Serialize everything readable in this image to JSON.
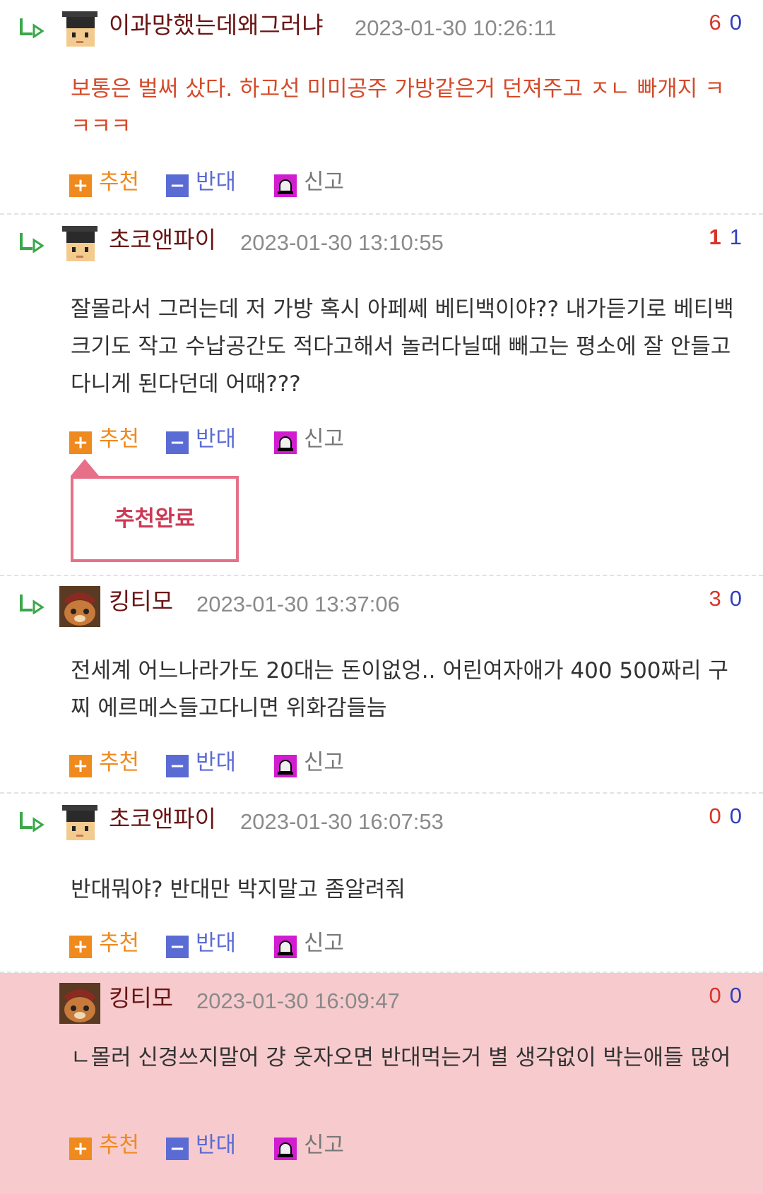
{
  "actions": {
    "recommend": "추천",
    "oppose": "반대",
    "report": "신고"
  },
  "tooltip": "추천완료",
  "comments": [
    {
      "nick": "이과망했는데왜그러냐",
      "date": "2023-01-30 10:26:11",
      "up": "6",
      "down": "0",
      "text": "보통은 벌써 샀다. 하고선 미미공주 가방같은거 던져주고 ㅈㄴ 빠개지 ㅋㅋㅋㅋ"
    },
    {
      "nick": "초코앤파이",
      "date": "2023-01-30 13:10:55",
      "up": "1",
      "down": "1",
      "text": "잘몰라서 그러는데 저 가방 혹시 아페쎄 베티백이야?? 내가듣기로 베티백 크기도 작고 수납공간도 적다고해서 놀러다닐때 빼고는 평소에 잘 안들고 다니게 된다던데 어때???"
    },
    {
      "nick": "킹티모",
      "date": "2023-01-30 13:37:06",
      "up": "3",
      "down": "0",
      "text": "전세계 어느나라가도 20대는 돈이없엉.. 어린여자애가 400 500짜리 구찌 에르메스들고다니면 위화감들늠"
    },
    {
      "nick": "초코앤파이",
      "date": "2023-01-30 16:07:53",
      "up": "0",
      "down": "0",
      "text": "반대뭐야? 반대만 박지말고 좀알려줘"
    },
    {
      "nick": "킹티모",
      "date": "2023-01-30 16:09:47",
      "up": "0",
      "down": "0",
      "text": "ㄴ몰러 신경쓰지말어 걍 웃자오면 반대먹는거 별 생각없이 박는애들 많어"
    }
  ],
  "colors": {
    "nick": "#6a1414",
    "date": "#8a8a8a",
    "up": "#d8342a",
    "down": "#2e3fbf",
    "highlight_bg": "#f7cbcd",
    "tooltip_border": "#e77089"
  }
}
